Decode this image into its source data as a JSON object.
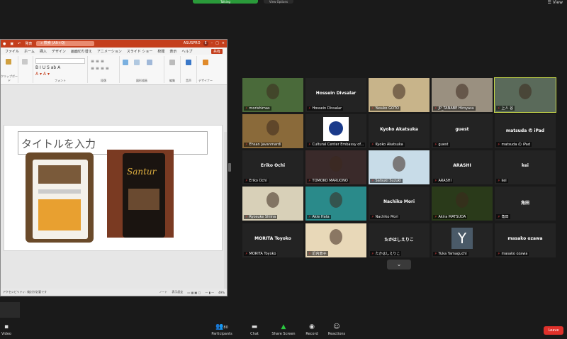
{
  "top": {
    "recording_label": "Talking",
    "status_label": "View Options",
    "view_label": "View"
  },
  "ppt": {
    "doc_title": "発表",
    "search_placeholder": "検索 (Alt+Q)",
    "user_label": "ASUSPRO",
    "user_initial": "E",
    "tabs": [
      "ファイル",
      "ホーム",
      "挿入",
      "デザイン",
      "画面切り替え",
      "アニメーション",
      "スライド ショー",
      "校閲",
      "表示",
      "ヘルプ"
    ],
    "share_label": "共有",
    "groups": [
      "クリップボード",
      "フォント",
      "段落",
      "図形描画",
      "編集",
      "音声",
      "デザイナー"
    ],
    "slide_title_placeholder": "タイトルを入力",
    "santur_text": "Santur",
    "status_left": "アクセシビリティ: 検討が必要です",
    "notes_label": "ノート",
    "display_settings": "表示設定",
    "zoom": "49%"
  },
  "gallery": [
    {
      "name": "morishimas",
      "label": "morishimas",
      "type": "photo",
      "bg": "#4a6a3a"
    },
    {
      "name": "Hossein Divsalar",
      "label": "Hossein Divsalar",
      "type": "text"
    },
    {
      "name": "Yasuko GOTO",
      "label": "Yasuko GOTO",
      "type": "photo",
      "bg": "#c8b48a"
    },
    {
      "name": "JP_TANABE Hiroyasu",
      "label": "JP_TANABE Hiroyasu",
      "type": "photo",
      "bg": "#9a9080"
    },
    {
      "name": "上人 谷",
      "label": "上人 谷",
      "type": "photo",
      "bg": "#5a6a5a",
      "active": true
    },
    {
      "name": "Ehsan Javanmardi",
      "label": "Ehsan Javanmardi",
      "type": "photo",
      "bg": "#8a6a3a"
    },
    {
      "name": "Cultural Center Embassy of...",
      "label": "Cultural Center Embassy of...",
      "type": "logo",
      "bg": "#ffffff"
    },
    {
      "name": "Kyoko Akatsuka",
      "label": "Kyoko Akatsuka",
      "type": "text"
    },
    {
      "name": "guest",
      "label": "guest",
      "type": "text"
    },
    {
      "name": "matsuda の iPad",
      "label": "matsuda の iPad",
      "type": "text"
    },
    {
      "name": "Eriko Ochi",
      "label": "Eriko Ochi",
      "type": "text"
    },
    {
      "name": "TOMOKO MARUONO",
      "label": "TOMOKO MARUONO",
      "type": "photo",
      "bg": "#3a2a2a"
    },
    {
      "name": "Satsuki Suzuki",
      "label": "Satsuki Suzuki",
      "type": "photo",
      "bg": "#c8dce8"
    },
    {
      "name": "ARASHI",
      "label": "ARASHI",
      "type": "text"
    },
    {
      "name": "kei",
      "label": "kei",
      "type": "text"
    },
    {
      "name": "Ryosuke Shiina",
      "label": "Ryosuke Shiina",
      "type": "photo",
      "bg": "#d8d0b8"
    },
    {
      "name": "Akie Hata",
      "label": "Akie Hata",
      "type": "photo",
      "bg": "#2a8a8a"
    },
    {
      "name": "Nachiko Mori",
      "label": "Nachiko Mori",
      "type": "text"
    },
    {
      "name": "Akira MATSUDA",
      "label": "Akira MATSUDA",
      "type": "photo",
      "bg": "#2a3a1a"
    },
    {
      "name": "角田",
      "label": "角田",
      "type": "text"
    },
    {
      "name": "MORITA Toyoko",
      "label": "MORITA Toyoko",
      "type": "text"
    },
    {
      "name": "近内恵子",
      "label": "近内恵子",
      "type": "photo",
      "bg": "#e8d8b8"
    },
    {
      "name": "たかはしえりこ",
      "label": "たかはしえりこ",
      "type": "text"
    },
    {
      "name": "Yuka Yamaguchi",
      "label": "Yuka Yamaguchi",
      "type": "initial",
      "initial": "Y"
    },
    {
      "name": "masako ozawa",
      "label": "masako ozawa",
      "type": "text"
    }
  ],
  "toolbar": {
    "video": "Video",
    "participants": "Participants",
    "participant_count": "80",
    "chat": "Chat",
    "share": "Share Screen",
    "record": "Record",
    "reactions": "Reactions",
    "leave": "Leave"
  }
}
